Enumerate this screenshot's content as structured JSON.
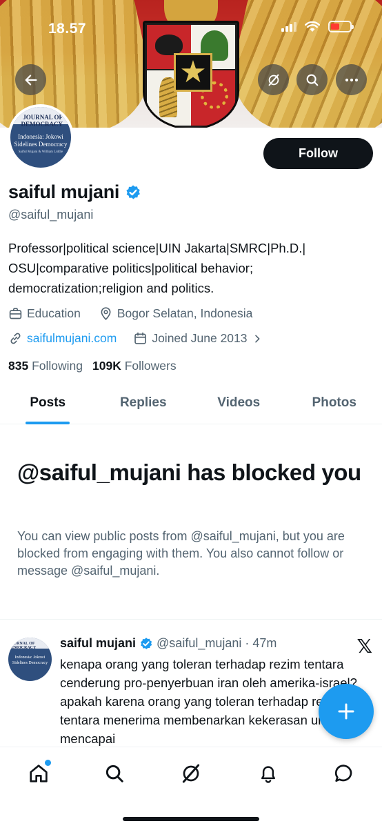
{
  "status_bar": {
    "time": "18.57"
  },
  "banner": {
    "description_icon": "garuda-pancasila-emblem"
  },
  "header_buttons": {
    "back_icon": "arrow-left-icon",
    "grok_icon": "grok-icon",
    "search_icon": "search-icon",
    "more_icon": "more-horizontal-icon"
  },
  "avatar": {
    "masthead": "JOURNAL OF DEMOCRACY",
    "headline": "Indonesia: Jokowi Sidelines Democracy",
    "byline": "Saiful Mujani & William Liddle"
  },
  "profile": {
    "follow_label": "Follow",
    "name": "saiful mujani",
    "verified": true,
    "handle": "@saiful_mujani",
    "bio": "Professor|political science|UIN Jakarta|SMRC|Ph.D.| OSU|comparative politics|political behavior; democratization;religion and politics.",
    "category": "Education",
    "location": "Bogor Selatan, Indonesia",
    "website": "saifulmujani.com",
    "joined": "Joined June 2013",
    "following_count": "835",
    "following_label": "Following",
    "followers_count": "109K",
    "followers_label": "Followers"
  },
  "tabs": [
    {
      "label": "Posts",
      "active": true
    },
    {
      "label": "Replies",
      "active": false
    },
    {
      "label": "Videos",
      "active": false
    },
    {
      "label": "Photos",
      "active": false
    }
  ],
  "blocked": {
    "title": "@saiful_mujani has blocked you",
    "description": "You can view public posts from @saiful_mujani, but you are blocked from engaging with them. You also cannot follow or message @saiful_mujani."
  },
  "post": {
    "author": "saiful mujani",
    "handle_time": "@saiful_mujani · 47m",
    "text": "kenapa orang yang toleran terhadap rezim tentara cenderung pro-penyerbuan iran oleh amerika-israel? apakah karena orang yang toleran terhadap rezim tentara menerima membenarkan kekerasan untuk mencapai",
    "source_icon": "x-logo-icon"
  },
  "fab": {
    "icon": "plus-icon"
  },
  "bottom_nav": [
    {
      "name": "home-icon",
      "active": true
    },
    {
      "name": "search-icon"
    },
    {
      "name": "grok-icon"
    },
    {
      "name": "notifications-bell-icon"
    },
    {
      "name": "messages-icon"
    }
  ],
  "colors": {
    "accent": "#1d9bf0",
    "text": "#0f1419",
    "secondary": "#536471"
  }
}
